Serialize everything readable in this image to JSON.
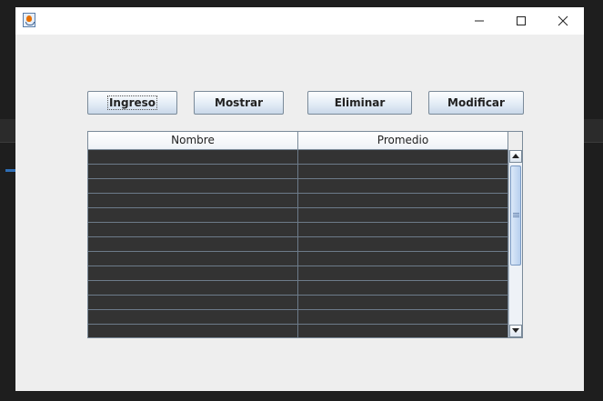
{
  "window": {
    "title": "",
    "icon": "java-cup-icon",
    "controls": [
      "minimize-icon",
      "maximize-icon",
      "close-icon"
    ]
  },
  "toolbar": {
    "ingreso_label": "Ingreso",
    "mostrar_label": "Mostrar",
    "eliminar_label": "Eliminar",
    "modificar_label": "Modificar"
  },
  "table": {
    "columns": [
      "Nombre",
      "Promedio"
    ],
    "rows": [
      [
        "",
        ""
      ],
      [
        "",
        ""
      ],
      [
        "",
        ""
      ],
      [
        "",
        ""
      ],
      [
        "",
        ""
      ],
      [
        "",
        ""
      ],
      [
        "",
        ""
      ],
      [
        "",
        ""
      ],
      [
        "",
        ""
      ],
      [
        "",
        ""
      ],
      [
        "",
        ""
      ],
      [
        "",
        ""
      ],
      [
        "",
        ""
      ]
    ]
  },
  "colors": {
    "table_body": "#333333",
    "window_bg": "#eeeeee",
    "desktop_bg": "#1e1e1e"
  }
}
